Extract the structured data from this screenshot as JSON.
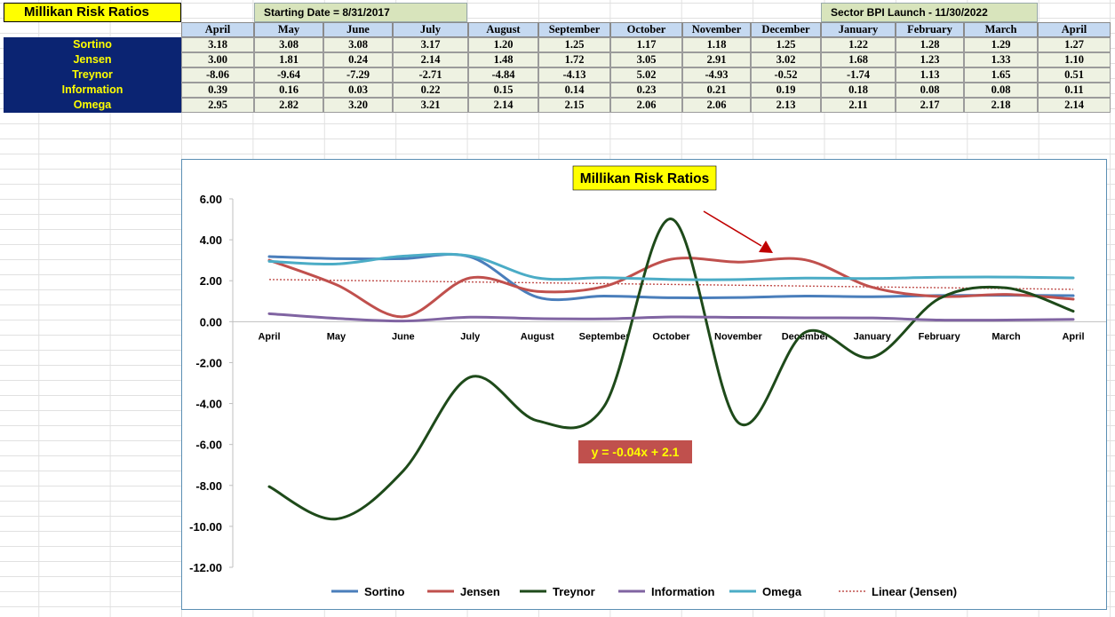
{
  "sheet": {
    "title": "Millikan Risk Ratios",
    "starting_date": "Starting Date = 8/31/2017",
    "sector_launch": "Sector BPI Launch - 11/30/2022",
    "columns": [
      "April",
      "May",
      "June",
      "July",
      "August",
      "September",
      "October",
      "November",
      "December",
      "January",
      "February",
      "March",
      "April"
    ],
    "rows": [
      {
        "label": "Sortino",
        "values": [
          "3.18",
          "3.08",
          "3.08",
          "3.17",
          "1.20",
          "1.25",
          "1.17",
          "1.18",
          "1.25",
          "1.22",
          "1.28",
          "1.29",
          "1.27"
        ]
      },
      {
        "label": "Jensen",
        "values": [
          "3.00",
          "1.81",
          "0.24",
          "2.14",
          "1.48",
          "1.72",
          "3.05",
          "2.91",
          "3.02",
          "1.68",
          "1.23",
          "1.33",
          "1.10"
        ]
      },
      {
        "label": "Treynor",
        "values": [
          "-8.06",
          "-9.64",
          "-7.29",
          "-2.71",
          "-4.84",
          "-4.13",
          "5.02",
          "-4.93",
          "-0.52",
          "-1.74",
          "1.13",
          "1.65",
          "0.51"
        ]
      },
      {
        "label": "Information",
        "values": [
          "0.39",
          "0.16",
          "0.03",
          "0.22",
          "0.15",
          "0.14",
          "0.23",
          "0.21",
          "0.19",
          "0.18",
          "0.08",
          "0.08",
          "0.11"
        ]
      },
      {
        "label": "Omega",
        "values": [
          "2.95",
          "2.82",
          "3.20",
          "3.21",
          "2.14",
          "2.15",
          "2.06",
          "2.06",
          "2.13",
          "2.11",
          "2.17",
          "2.18",
          "2.14"
        ]
      }
    ]
  },
  "chart_data": {
    "type": "line",
    "title": "Millikan Risk Ratios",
    "categories": [
      "April",
      "May",
      "June",
      "July",
      "August",
      "September",
      "October",
      "November",
      "December",
      "January",
      "February",
      "March",
      "April"
    ],
    "ylim": [
      -12,
      6
    ],
    "yticks": [
      "6.00",
      "4.00",
      "2.00",
      "0.00",
      "-2.00",
      "-4.00",
      "-6.00",
      "-8.00",
      "-10.00",
      "-12.00"
    ],
    "grid": false,
    "legend_position": "bottom",
    "series": [
      {
        "name": "Sortino",
        "color": "#4a7ebb",
        "values": [
          3.18,
          3.08,
          3.08,
          3.17,
          1.2,
          1.25,
          1.17,
          1.18,
          1.25,
          1.22,
          1.28,
          1.29,
          1.27
        ]
      },
      {
        "name": "Jensen",
        "color": "#c0504d",
        "values": [
          3.0,
          1.81,
          0.24,
          2.14,
          1.48,
          1.72,
          3.05,
          2.91,
          3.02,
          1.68,
          1.23,
          1.33,
          1.1
        ]
      },
      {
        "name": "Treynor",
        "color": "#1e4a1a",
        "values": [
          -8.06,
          -9.64,
          -7.29,
          -2.71,
          -4.84,
          -4.13,
          5.02,
          -4.93,
          -0.52,
          -1.74,
          1.13,
          1.65,
          0.51
        ]
      },
      {
        "name": "Information",
        "color": "#8064a2",
        "values": [
          0.39,
          0.16,
          0.03,
          0.22,
          0.15,
          0.14,
          0.23,
          0.21,
          0.19,
          0.18,
          0.08,
          0.08,
          0.11
        ]
      },
      {
        "name": "Omega",
        "color": "#4bacc6",
        "values": [
          2.95,
          2.82,
          3.2,
          3.21,
          2.14,
          2.15,
          2.06,
          2.06,
          2.13,
          2.11,
          2.17,
          2.18,
          2.14
        ]
      }
    ],
    "trendline": {
      "name": "Linear (Jensen)",
      "color": "#c0504d",
      "slope": -0.04,
      "intercept": 2.1,
      "equation": "y = -0.04x + 2.1"
    }
  }
}
